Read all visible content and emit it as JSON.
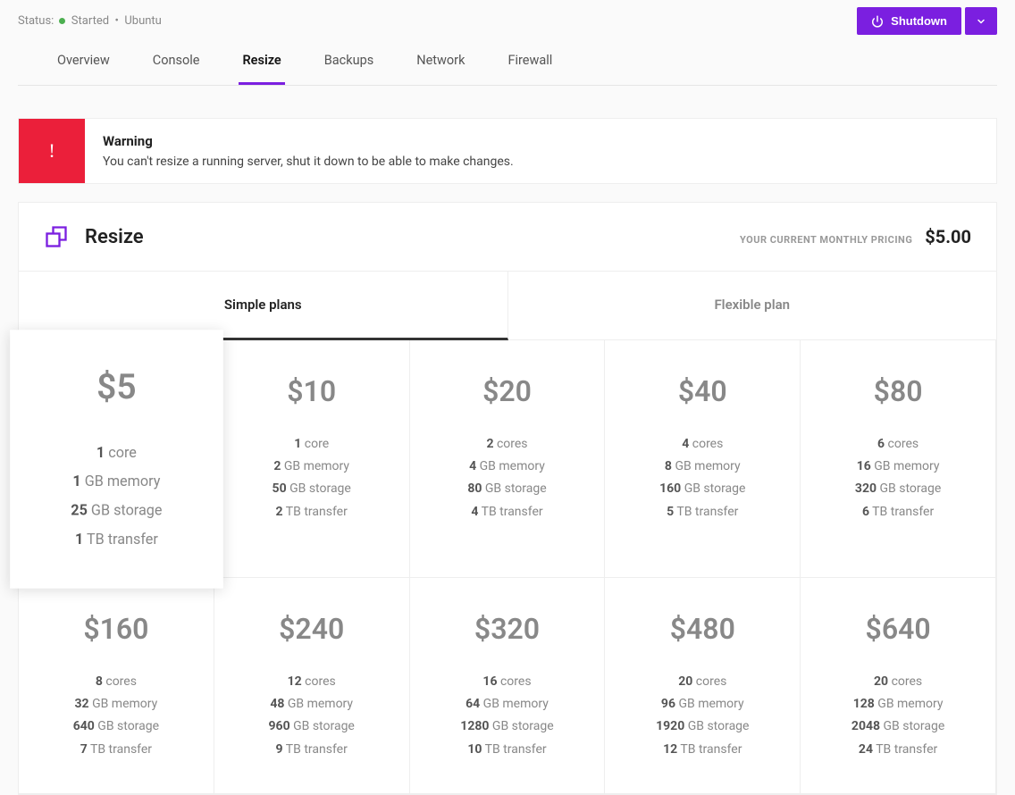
{
  "status": {
    "label": "Status:",
    "value": "Started",
    "os": "Ubuntu"
  },
  "shutdown_label": "Shutdown",
  "tabs": [
    "Overview",
    "Console",
    "Resize",
    "Backups",
    "Network",
    "Firewall"
  ],
  "warning": {
    "title": "Warning",
    "desc": "You can't resize a running server, shut it down to be able to make changes."
  },
  "panel": {
    "title": "Resize",
    "pricing_label": "YOUR CURRENT MONTHLY PRICING",
    "pricing_value": "$5.00"
  },
  "plan_tabs": [
    "Simple plans",
    "Flexible plan"
  ],
  "plans": [
    {
      "price": "$5",
      "cores": "1",
      "core_unit": "core",
      "mem": "1",
      "mem_unit": "GB memory",
      "storage": "25",
      "storage_unit": "GB storage",
      "transfer": "1",
      "transfer_unit": "TB transfer",
      "selected": true
    },
    {
      "price": "$10",
      "cores": "1",
      "core_unit": "core",
      "mem": "2",
      "mem_unit": "GB memory",
      "storage": "50",
      "storage_unit": "GB storage",
      "transfer": "2",
      "transfer_unit": "TB transfer",
      "selected": false
    },
    {
      "price": "$20",
      "cores": "2",
      "core_unit": "cores",
      "mem": "4",
      "mem_unit": "GB memory",
      "storage": "80",
      "storage_unit": "GB storage",
      "transfer": "4",
      "transfer_unit": "TB transfer",
      "selected": false
    },
    {
      "price": "$40",
      "cores": "4",
      "core_unit": "cores",
      "mem": "8",
      "mem_unit": "GB memory",
      "storage": "160",
      "storage_unit": "GB storage",
      "transfer": "5",
      "transfer_unit": "TB transfer",
      "selected": false
    },
    {
      "price": "$80",
      "cores": "6",
      "core_unit": "cores",
      "mem": "16",
      "mem_unit": "GB memory",
      "storage": "320",
      "storage_unit": "GB storage",
      "transfer": "6",
      "transfer_unit": "TB transfer",
      "selected": false
    },
    {
      "price": "$160",
      "cores": "8",
      "core_unit": "cores",
      "mem": "32",
      "mem_unit": "GB memory",
      "storage": "640",
      "storage_unit": "GB storage",
      "transfer": "7",
      "transfer_unit": "TB transfer",
      "selected": false
    },
    {
      "price": "$240",
      "cores": "12",
      "core_unit": "cores",
      "mem": "48",
      "mem_unit": "GB memory",
      "storage": "960",
      "storage_unit": "GB storage",
      "transfer": "9",
      "transfer_unit": "TB transfer",
      "selected": false
    },
    {
      "price": "$320",
      "cores": "16",
      "core_unit": "cores",
      "mem": "64",
      "mem_unit": "GB memory",
      "storage": "1280",
      "storage_unit": "GB storage",
      "transfer": "10",
      "transfer_unit": "TB transfer",
      "selected": false
    },
    {
      "price": "$480",
      "cores": "20",
      "core_unit": "cores",
      "mem": "96",
      "mem_unit": "GB memory",
      "storage": "1920",
      "storage_unit": "GB storage",
      "transfer": "12",
      "transfer_unit": "TB transfer",
      "selected": false
    },
    {
      "price": "$640",
      "cores": "20",
      "core_unit": "cores",
      "mem": "128",
      "mem_unit": "GB memory",
      "storage": "2048",
      "storage_unit": "GB storage",
      "transfer": "24",
      "transfer_unit": "TB transfer",
      "selected": false
    }
  ]
}
